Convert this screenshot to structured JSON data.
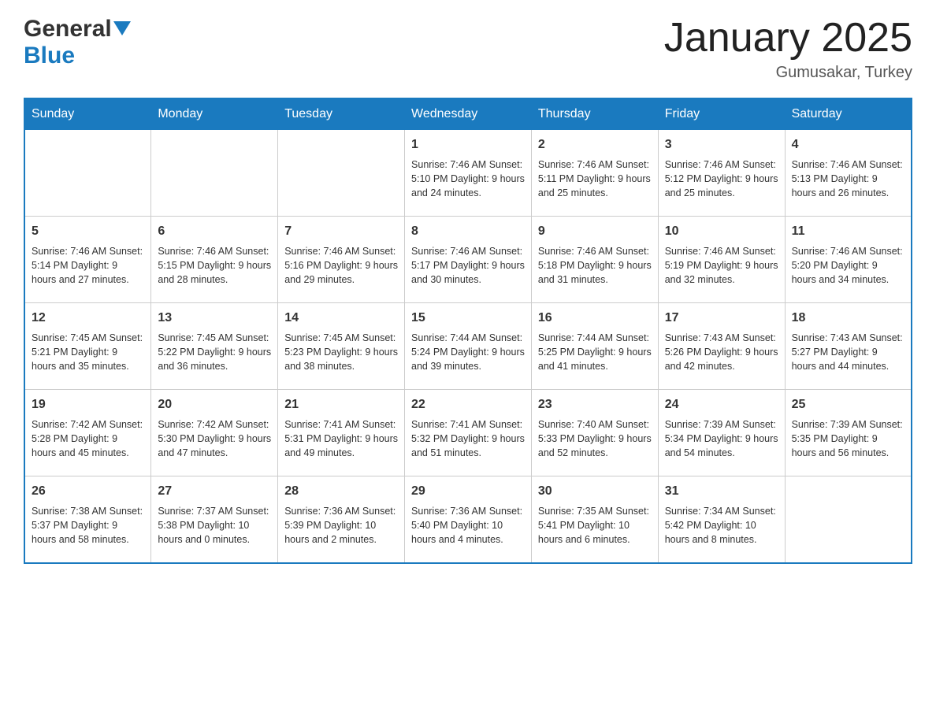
{
  "header": {
    "logo_general": "General",
    "logo_blue": "Blue",
    "title": "January 2025",
    "subtitle": "Gumusakar, Turkey"
  },
  "days_of_week": [
    "Sunday",
    "Monday",
    "Tuesday",
    "Wednesday",
    "Thursday",
    "Friday",
    "Saturday"
  ],
  "weeks": [
    {
      "days": [
        {
          "number": "",
          "info": ""
        },
        {
          "number": "",
          "info": ""
        },
        {
          "number": "",
          "info": ""
        },
        {
          "number": "1",
          "info": "Sunrise: 7:46 AM\nSunset: 5:10 PM\nDaylight: 9 hours\nand 24 minutes."
        },
        {
          "number": "2",
          "info": "Sunrise: 7:46 AM\nSunset: 5:11 PM\nDaylight: 9 hours\nand 25 minutes."
        },
        {
          "number": "3",
          "info": "Sunrise: 7:46 AM\nSunset: 5:12 PM\nDaylight: 9 hours\nand 25 minutes."
        },
        {
          "number": "4",
          "info": "Sunrise: 7:46 AM\nSunset: 5:13 PM\nDaylight: 9 hours\nand 26 minutes."
        }
      ]
    },
    {
      "days": [
        {
          "number": "5",
          "info": "Sunrise: 7:46 AM\nSunset: 5:14 PM\nDaylight: 9 hours\nand 27 minutes."
        },
        {
          "number": "6",
          "info": "Sunrise: 7:46 AM\nSunset: 5:15 PM\nDaylight: 9 hours\nand 28 minutes."
        },
        {
          "number": "7",
          "info": "Sunrise: 7:46 AM\nSunset: 5:16 PM\nDaylight: 9 hours\nand 29 minutes."
        },
        {
          "number": "8",
          "info": "Sunrise: 7:46 AM\nSunset: 5:17 PM\nDaylight: 9 hours\nand 30 minutes."
        },
        {
          "number": "9",
          "info": "Sunrise: 7:46 AM\nSunset: 5:18 PM\nDaylight: 9 hours\nand 31 minutes."
        },
        {
          "number": "10",
          "info": "Sunrise: 7:46 AM\nSunset: 5:19 PM\nDaylight: 9 hours\nand 32 minutes."
        },
        {
          "number": "11",
          "info": "Sunrise: 7:46 AM\nSunset: 5:20 PM\nDaylight: 9 hours\nand 34 minutes."
        }
      ]
    },
    {
      "days": [
        {
          "number": "12",
          "info": "Sunrise: 7:45 AM\nSunset: 5:21 PM\nDaylight: 9 hours\nand 35 minutes."
        },
        {
          "number": "13",
          "info": "Sunrise: 7:45 AM\nSunset: 5:22 PM\nDaylight: 9 hours\nand 36 minutes."
        },
        {
          "number": "14",
          "info": "Sunrise: 7:45 AM\nSunset: 5:23 PM\nDaylight: 9 hours\nand 38 minutes."
        },
        {
          "number": "15",
          "info": "Sunrise: 7:44 AM\nSunset: 5:24 PM\nDaylight: 9 hours\nand 39 minutes."
        },
        {
          "number": "16",
          "info": "Sunrise: 7:44 AM\nSunset: 5:25 PM\nDaylight: 9 hours\nand 41 minutes."
        },
        {
          "number": "17",
          "info": "Sunrise: 7:43 AM\nSunset: 5:26 PM\nDaylight: 9 hours\nand 42 minutes."
        },
        {
          "number": "18",
          "info": "Sunrise: 7:43 AM\nSunset: 5:27 PM\nDaylight: 9 hours\nand 44 minutes."
        }
      ]
    },
    {
      "days": [
        {
          "number": "19",
          "info": "Sunrise: 7:42 AM\nSunset: 5:28 PM\nDaylight: 9 hours\nand 45 minutes."
        },
        {
          "number": "20",
          "info": "Sunrise: 7:42 AM\nSunset: 5:30 PM\nDaylight: 9 hours\nand 47 minutes."
        },
        {
          "number": "21",
          "info": "Sunrise: 7:41 AM\nSunset: 5:31 PM\nDaylight: 9 hours\nand 49 minutes."
        },
        {
          "number": "22",
          "info": "Sunrise: 7:41 AM\nSunset: 5:32 PM\nDaylight: 9 hours\nand 51 minutes."
        },
        {
          "number": "23",
          "info": "Sunrise: 7:40 AM\nSunset: 5:33 PM\nDaylight: 9 hours\nand 52 minutes."
        },
        {
          "number": "24",
          "info": "Sunrise: 7:39 AM\nSunset: 5:34 PM\nDaylight: 9 hours\nand 54 minutes."
        },
        {
          "number": "25",
          "info": "Sunrise: 7:39 AM\nSunset: 5:35 PM\nDaylight: 9 hours\nand 56 minutes."
        }
      ]
    },
    {
      "days": [
        {
          "number": "26",
          "info": "Sunrise: 7:38 AM\nSunset: 5:37 PM\nDaylight: 9 hours\nand 58 minutes."
        },
        {
          "number": "27",
          "info": "Sunrise: 7:37 AM\nSunset: 5:38 PM\nDaylight: 10 hours\nand 0 minutes."
        },
        {
          "number": "28",
          "info": "Sunrise: 7:36 AM\nSunset: 5:39 PM\nDaylight: 10 hours\nand 2 minutes."
        },
        {
          "number": "29",
          "info": "Sunrise: 7:36 AM\nSunset: 5:40 PM\nDaylight: 10 hours\nand 4 minutes."
        },
        {
          "number": "30",
          "info": "Sunrise: 7:35 AM\nSunset: 5:41 PM\nDaylight: 10 hours\nand 6 minutes."
        },
        {
          "number": "31",
          "info": "Sunrise: 7:34 AM\nSunset: 5:42 PM\nDaylight: 10 hours\nand 8 minutes."
        },
        {
          "number": "",
          "info": ""
        }
      ]
    }
  ]
}
